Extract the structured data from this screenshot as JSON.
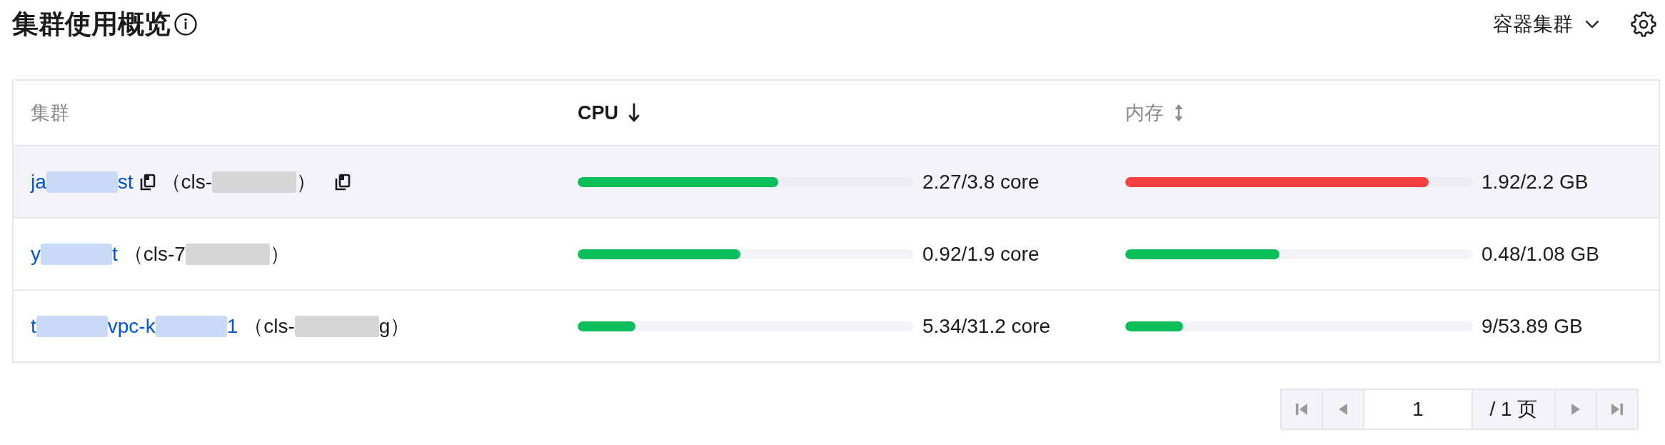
{
  "header": {
    "title": "集群使用概览",
    "cluster_type": "容器集群"
  },
  "table": {
    "columns": [
      {
        "label": "集群",
        "kind": "plain"
      },
      {
        "label": "CPU",
        "kind": "sorted"
      },
      {
        "label": "内存",
        "kind": "sortable"
      }
    ],
    "rows": [
      {
        "hovered": true,
        "name": [
          {
            "kind": "text",
            "text": "ja"
          },
          {
            "kind": "redacted"
          },
          {
            "kind": "text",
            "text": "st"
          }
        ],
        "name_copy": true,
        "cluster_id": [
          {
            "kind": "text",
            "text": "（cls-"
          },
          {
            "kind": "redacted"
          },
          {
            "kind": "text",
            "text": "）"
          }
        ],
        "id_copy": true,
        "usage": [
          {
            "level": 0.597,
            "reading": "2.27/3.8 core",
            "color": "#0abf5b"
          },
          {
            "level": 0.873,
            "reading": "1.92/2.2 GB",
            "color": "#f64041"
          }
        ]
      },
      {
        "hovered": false,
        "name": [
          {
            "kind": "text",
            "text": "y"
          },
          {
            "kind": "redacted"
          },
          {
            "kind": "text",
            "text": "t"
          }
        ],
        "name_copy": false,
        "cluster_id": [
          {
            "kind": "text",
            "text": "（cls-7"
          },
          {
            "kind": "redacted"
          },
          {
            "kind": "text",
            "text": "）"
          }
        ],
        "id_copy": false,
        "usage": [
          {
            "level": 0.484,
            "reading": "0.92/1.9 core",
            "color": "#0abf5b"
          },
          {
            "level": 0.444,
            "reading": "0.48/1.08 GB",
            "color": "#0abf5b"
          }
        ]
      },
      {
        "hovered": false,
        "name": [
          {
            "kind": "text",
            "text": "t"
          },
          {
            "kind": "redacted"
          },
          {
            "kind": "text",
            "text": "vpc-k"
          },
          {
            "kind": "redacted"
          },
          {
            "kind": "text",
            "text": "1"
          }
        ],
        "name_copy": false,
        "cluster_id": [
          {
            "kind": "text",
            "text": "（cls-"
          },
          {
            "kind": "redacted"
          },
          {
            "kind": "text",
            "text": "g）"
          }
        ],
        "id_copy": false,
        "usage": [
          {
            "level": 0.171,
            "reading": "5.34/31.2 core",
            "color": "#0abf5b"
          },
          {
            "level": 0.167,
            "reading": "9/53.89 GB",
            "color": "#0abf5b"
          }
        ]
      }
    ]
  },
  "pagination": {
    "first": {
      "disabled": true
    },
    "prev": {
      "disabled": true
    },
    "page": "1",
    "total": "/ 1 页",
    "next": {
      "disabled": true
    },
    "last": {
      "disabled": true
    }
  }
}
